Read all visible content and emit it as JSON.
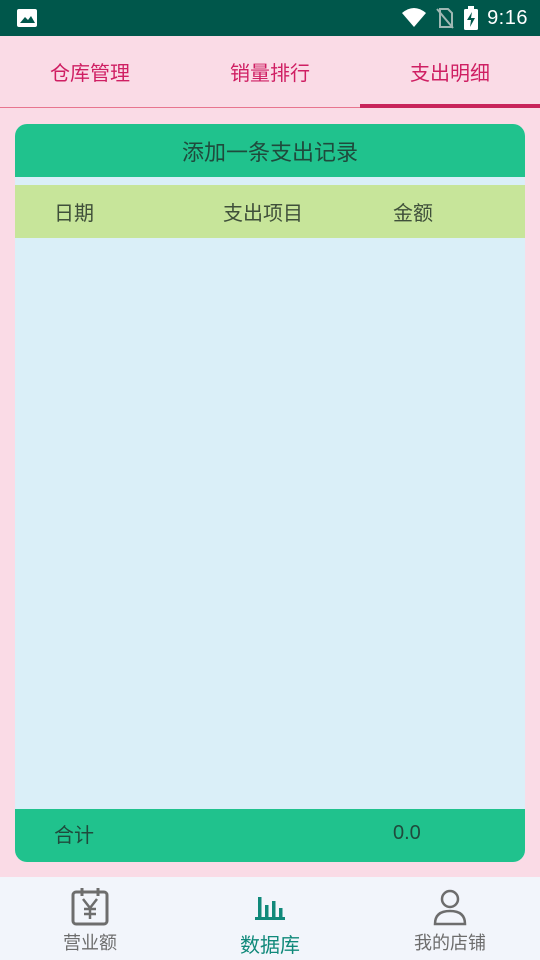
{
  "status_bar": {
    "time": "9:16"
  },
  "tabs": [
    {
      "label": "仓库管理"
    },
    {
      "label": "销量排行"
    },
    {
      "label": "支出明细"
    }
  ],
  "add_button_label": "添加一条支出记录",
  "table": {
    "headers": [
      "日期",
      "支出项目",
      "金额"
    ],
    "rows": []
  },
  "footer": {
    "label": "合计",
    "total": "0.0"
  },
  "bottom_nav": [
    {
      "label": "营业额",
      "icon": "calendar-yen-icon"
    },
    {
      "label": "数据库",
      "icon": "bar-chart-icon"
    },
    {
      "label": "我的店铺",
      "icon": "person-icon"
    }
  ],
  "colors": {
    "status_bar": "#00574b",
    "accent_pink": "#cf1f63",
    "green": "#20c28d",
    "header_green": "#c7e59a",
    "body_bg": "#daeff8",
    "nav_active": "#10897a"
  }
}
